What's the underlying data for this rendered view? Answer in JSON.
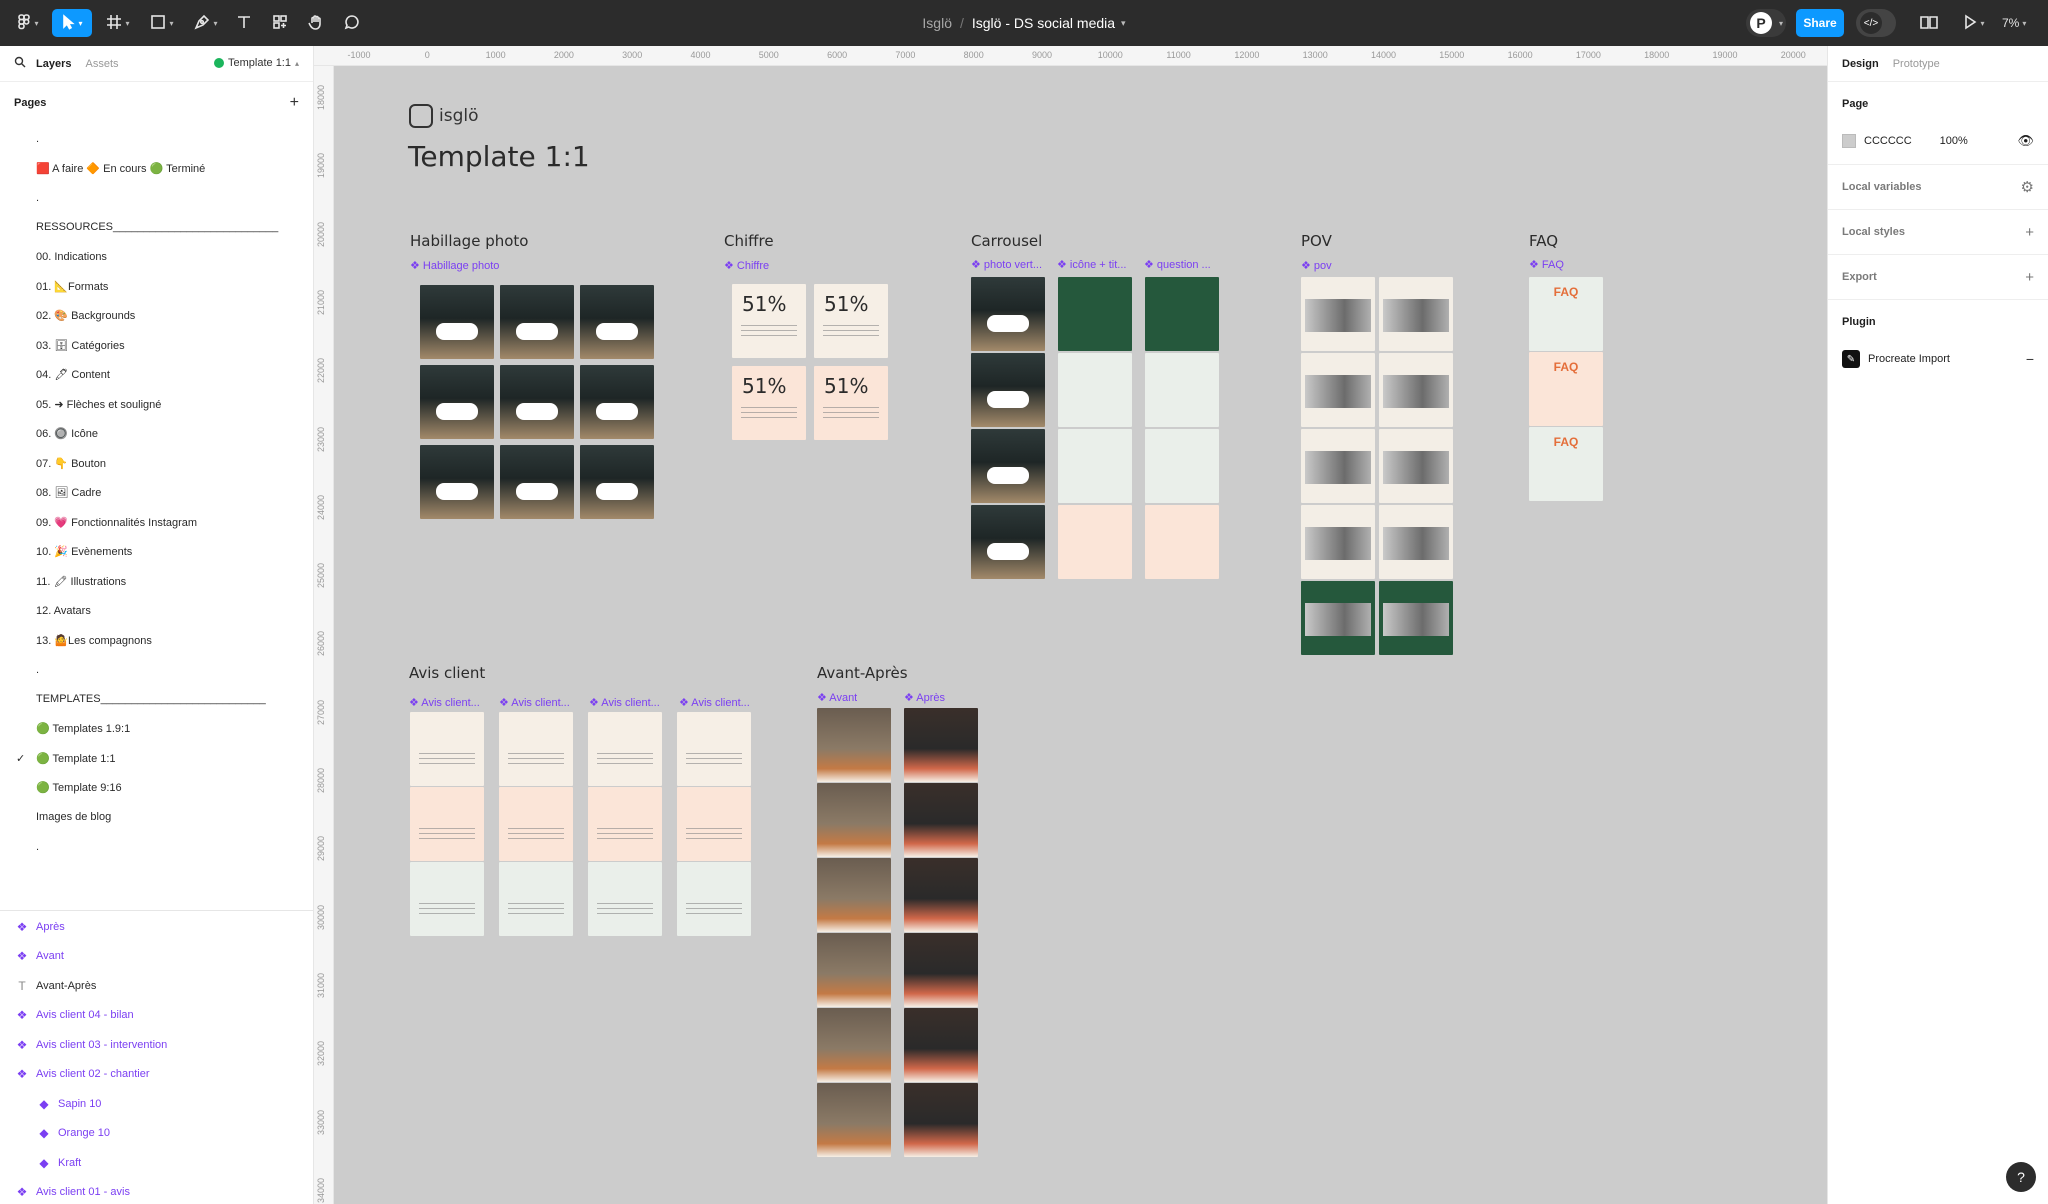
{
  "toolbar": {
    "breadcrumb_team": "Isglö",
    "breadcrumb_sep": "/",
    "file_name": "Isglö - DS social media",
    "share_label": "Share",
    "avatar_letter": "P",
    "zoom_label": "7%"
  },
  "left_panel": {
    "tabs": {
      "layers": "Layers",
      "assets": "Assets"
    },
    "current_page": "Template 1:1",
    "pages_heading": "Pages",
    "pages": [
      {
        "label": "."
      },
      {
        "label": "🟥 A faire   🔶 En cours   🟢 Terminé"
      },
      {
        "label": "."
      },
      {
        "label": "RESSOURCES___________________________"
      },
      {
        "label": "00. Indications"
      },
      {
        "label": "01. 📐Formats"
      },
      {
        "label": "02. 🎨 Backgrounds"
      },
      {
        "label": "03. 🗄 Catégories"
      },
      {
        "label": "04. 🖊 Content"
      },
      {
        "label": "05. ➜ Flèches et souligné"
      },
      {
        "label": "06. 🔘 Icône"
      },
      {
        "label": "07. 👇 Bouton"
      },
      {
        "label": "08. 🖼 Cadre"
      },
      {
        "label": "09. 💗 Fonctionnalités Instagram"
      },
      {
        "label": "10. 🎉 Evènements"
      },
      {
        "label": "11. 🖍 Illustrations"
      },
      {
        "label": "12. Avatars"
      },
      {
        "label": "13. 🤷Les compagnons"
      },
      {
        "label": "."
      },
      {
        "label": "TEMPLATES___________________________"
      },
      {
        "label": "🟢 Templates 1.9:1"
      },
      {
        "label": "🟢 Template 1:1",
        "checked": "✓"
      },
      {
        "label": "🟢 Template 9:16"
      },
      {
        "label": "Images de blog"
      },
      {
        "label": "."
      }
    ],
    "layers": [
      {
        "label": "Après",
        "icon": "❖"
      },
      {
        "label": "Avant",
        "icon": "❖"
      },
      {
        "label": "Avant-Après",
        "icon": "T"
      },
      {
        "label": "Avis client 04 - bilan",
        "icon": "❖"
      },
      {
        "label": "Avis client 03 - intervention",
        "icon": "❖"
      },
      {
        "label": "Avis client 02 - chantier",
        "icon": "❖"
      },
      {
        "label": "Sapin 10",
        "icon": "◆"
      },
      {
        "label": "Orange 10",
        "icon": "◆"
      },
      {
        "label": "Kraft",
        "icon": "◆"
      },
      {
        "label": "Avis client 01 - avis",
        "icon": "❖"
      }
    ]
  },
  "ruler": {
    "x_ticks": [
      "-1000",
      "0",
      "1000",
      "2000",
      "3000",
      "4000",
      "5000",
      "6000",
      "7000",
      "8000",
      "9000",
      "10000",
      "11000",
      "12000",
      "13000",
      "14000",
      "15000",
      "16000",
      "17000",
      "18000",
      "19000",
      "20000"
    ],
    "y_ticks": [
      "18000",
      "19000",
      "20000",
      "21000",
      "22000",
      "23000",
      "24000",
      "25000",
      "26000",
      "27000",
      "28000",
      "29000",
      "30000",
      "31000",
      "32000",
      "33000",
      "34000"
    ]
  },
  "canvas": {
    "logo_text": "isglö",
    "title": "Template 1:1",
    "sections": {
      "habillage": {
        "title": "Habillage photo",
        "label": "❖ Habillage photo"
      },
      "chiffre": {
        "title": "Chiffre",
        "label": "❖ Chiffre",
        "pct": "51%"
      },
      "carrousel": {
        "title": "Carrousel",
        "labels": [
          "❖ photo vert...",
          "❖ icône + tit...",
          "❖ question ..."
        ]
      },
      "pov": {
        "title": "POV",
        "label": "❖ pov"
      },
      "faq": {
        "title": "FAQ",
        "label": "❖ FAQ",
        "card_text": "FAQ"
      },
      "avis": {
        "title": "Avis client",
        "labels": [
          "❖ Avis client...",
          "❖ Avis client...",
          "❖ Avis client...",
          "❖ Avis client..."
        ]
      },
      "avant_apres": {
        "title": "Avant-Après",
        "labels": [
          "❖ Avant",
          "❖ Après"
        ]
      }
    }
  },
  "right_panel": {
    "tabs": {
      "design": "Design",
      "prototype": "Prototype"
    },
    "page_heading": "Page",
    "page_color": "CCCCCC",
    "page_opacity": "100%",
    "local_variables": "Local variables",
    "local_styles": "Local styles",
    "export": "Export",
    "plugin_heading": "Plugin",
    "plugin_name": "Procreate Import"
  },
  "help_label": "?",
  "colors": {
    "accent": "#0d99ff",
    "component_purple": "#7b3ff2",
    "canvas_bg": "#cccccc",
    "brand_green": "#25583c",
    "brand_orange": "#e46e3a"
  }
}
